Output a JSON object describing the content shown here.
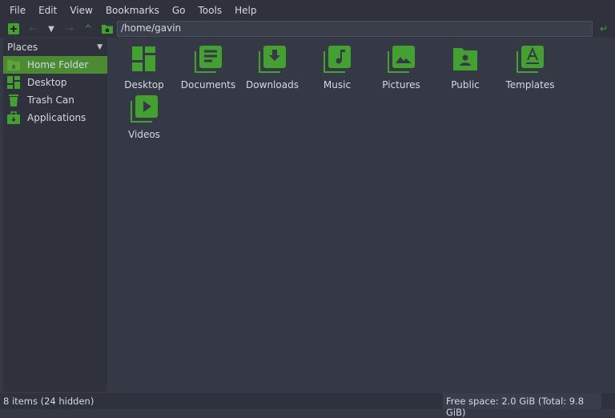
{
  "menu": [
    {
      "label": "File"
    },
    {
      "label": "Edit"
    },
    {
      "label": "View"
    },
    {
      "label": "Bookmarks"
    },
    {
      "label": "Go"
    },
    {
      "label": "Tools"
    },
    {
      "label": "Help"
    }
  ],
  "toolbar": {
    "path": "/home/gavin"
  },
  "sidebar": {
    "header": "Places",
    "items": [
      {
        "label": "Home Folder"
      },
      {
        "label": "Desktop"
      },
      {
        "label": "Trash Can"
      },
      {
        "label": "Applications"
      }
    ]
  },
  "files": [
    {
      "label": "Desktop"
    },
    {
      "label": "Documents"
    },
    {
      "label": "Downloads"
    },
    {
      "label": "Music"
    },
    {
      "label": "Pictures"
    },
    {
      "label": "Public"
    },
    {
      "label": "Templates"
    },
    {
      "label": "Videos"
    }
  ],
  "status": {
    "items": "8 items (24 hidden)",
    "space": "Free space: 2.0 GiB (Total: 9.8 GiB)"
  },
  "colors": {
    "accent": "#45a032",
    "bg": "#353945"
  }
}
